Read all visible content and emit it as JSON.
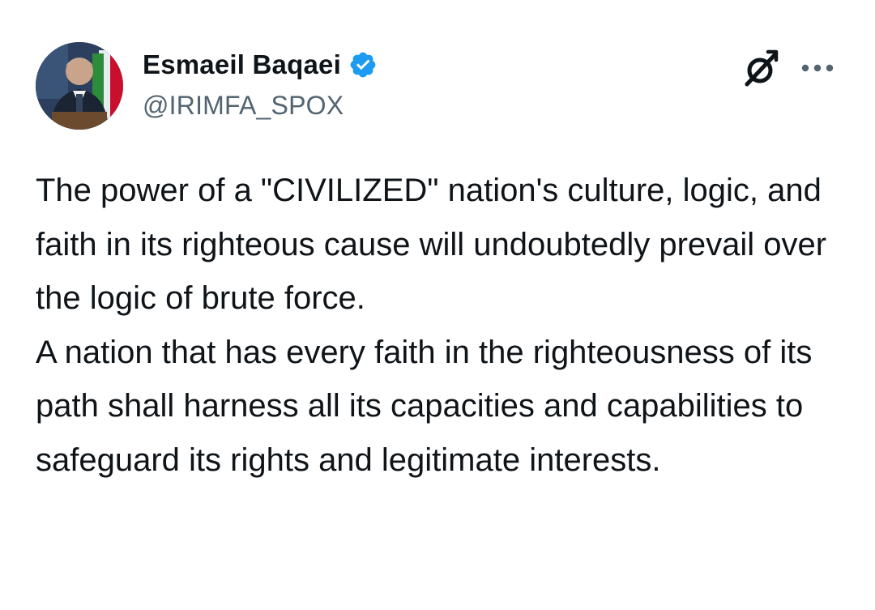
{
  "author": {
    "display_name": "Esmaeil Baqaei",
    "handle": "@IRIMFA_SPOX",
    "verified": true,
    "verified_color": "#1d9bf0",
    "avatar_icon": "profile-photo"
  },
  "header_actions": {
    "grok_icon": "grok-icon",
    "more_icon": "more-horizontal-icon"
  },
  "tweet": {
    "paragraphs": [
      "The power of a \"CIVILIZED\" nation's culture, logic, and faith in its righteous cause will undoubtedly prevail over the logic of brute force.",
      "A nation that has every faith in the righteousness of its path shall harness all its capacities and capabilities to safeguard its rights and legitimate interests."
    ]
  }
}
